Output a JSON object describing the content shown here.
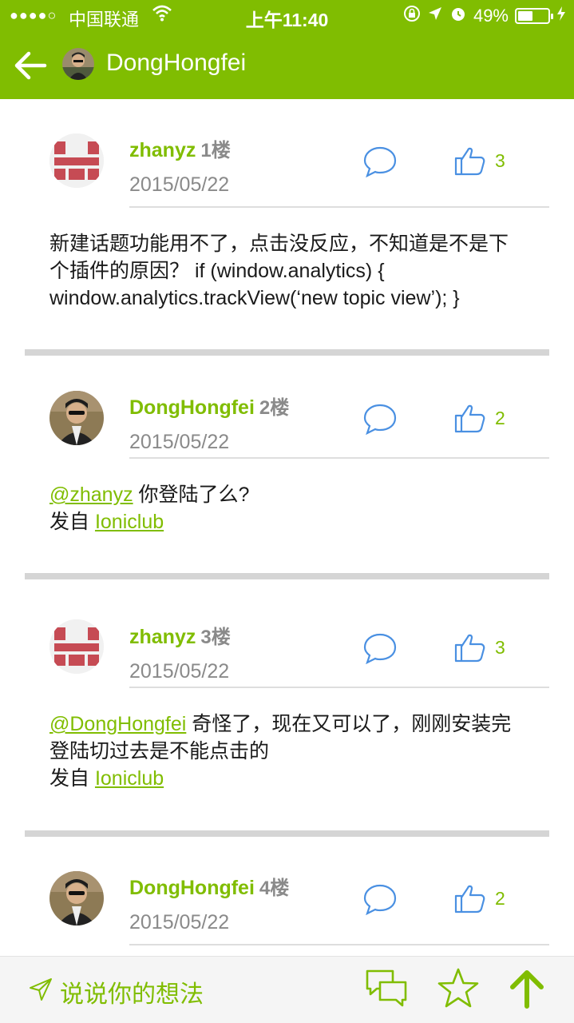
{
  "status": {
    "signal": "●●●●○",
    "carrier": "中国联通",
    "time": "上午11:40",
    "battery": "49%",
    "battery_level": 0.49
  },
  "header": {
    "title": "DongHongfei"
  },
  "replies": [
    {
      "user": "zhanyz",
      "floor": "1楼",
      "date": "2015/05/22",
      "likes": "3",
      "content_text": "新建话题功能用不了，点击没反应，不知道是不是下个插件的原因？ if (window.analytics) { window.analytics.trackView(‘new topic view’); }"
    },
    {
      "user": "DongHongfei",
      "floor": "2楼",
      "date": "2015/05/22",
      "likes": "2",
      "mention": "@zhanyz",
      "content_text": " 你登陆了么?",
      "from_label": "发自 ",
      "from_link": "Ioniclub"
    },
    {
      "user": "zhanyz",
      "floor": "3楼",
      "date": "2015/05/22",
      "likes": "3",
      "mention": "@DongHongfei",
      "content_text": " 奇怪了，现在又可以了，刚刚安装完登陆切过去是不能点击的",
      "from_label": "发自 ",
      "from_link": "Ioniclub"
    },
    {
      "user": "DongHongfei",
      "floor": "4楼",
      "date": "2015/05/22",
      "likes": "2"
    }
  ],
  "bottom_bar": {
    "compose_placeholder": "说说你的想法"
  },
  "colors": {
    "accent": "#80bd01",
    "icon_blue": "#4a90e2",
    "separator": "#d5d5d5"
  }
}
